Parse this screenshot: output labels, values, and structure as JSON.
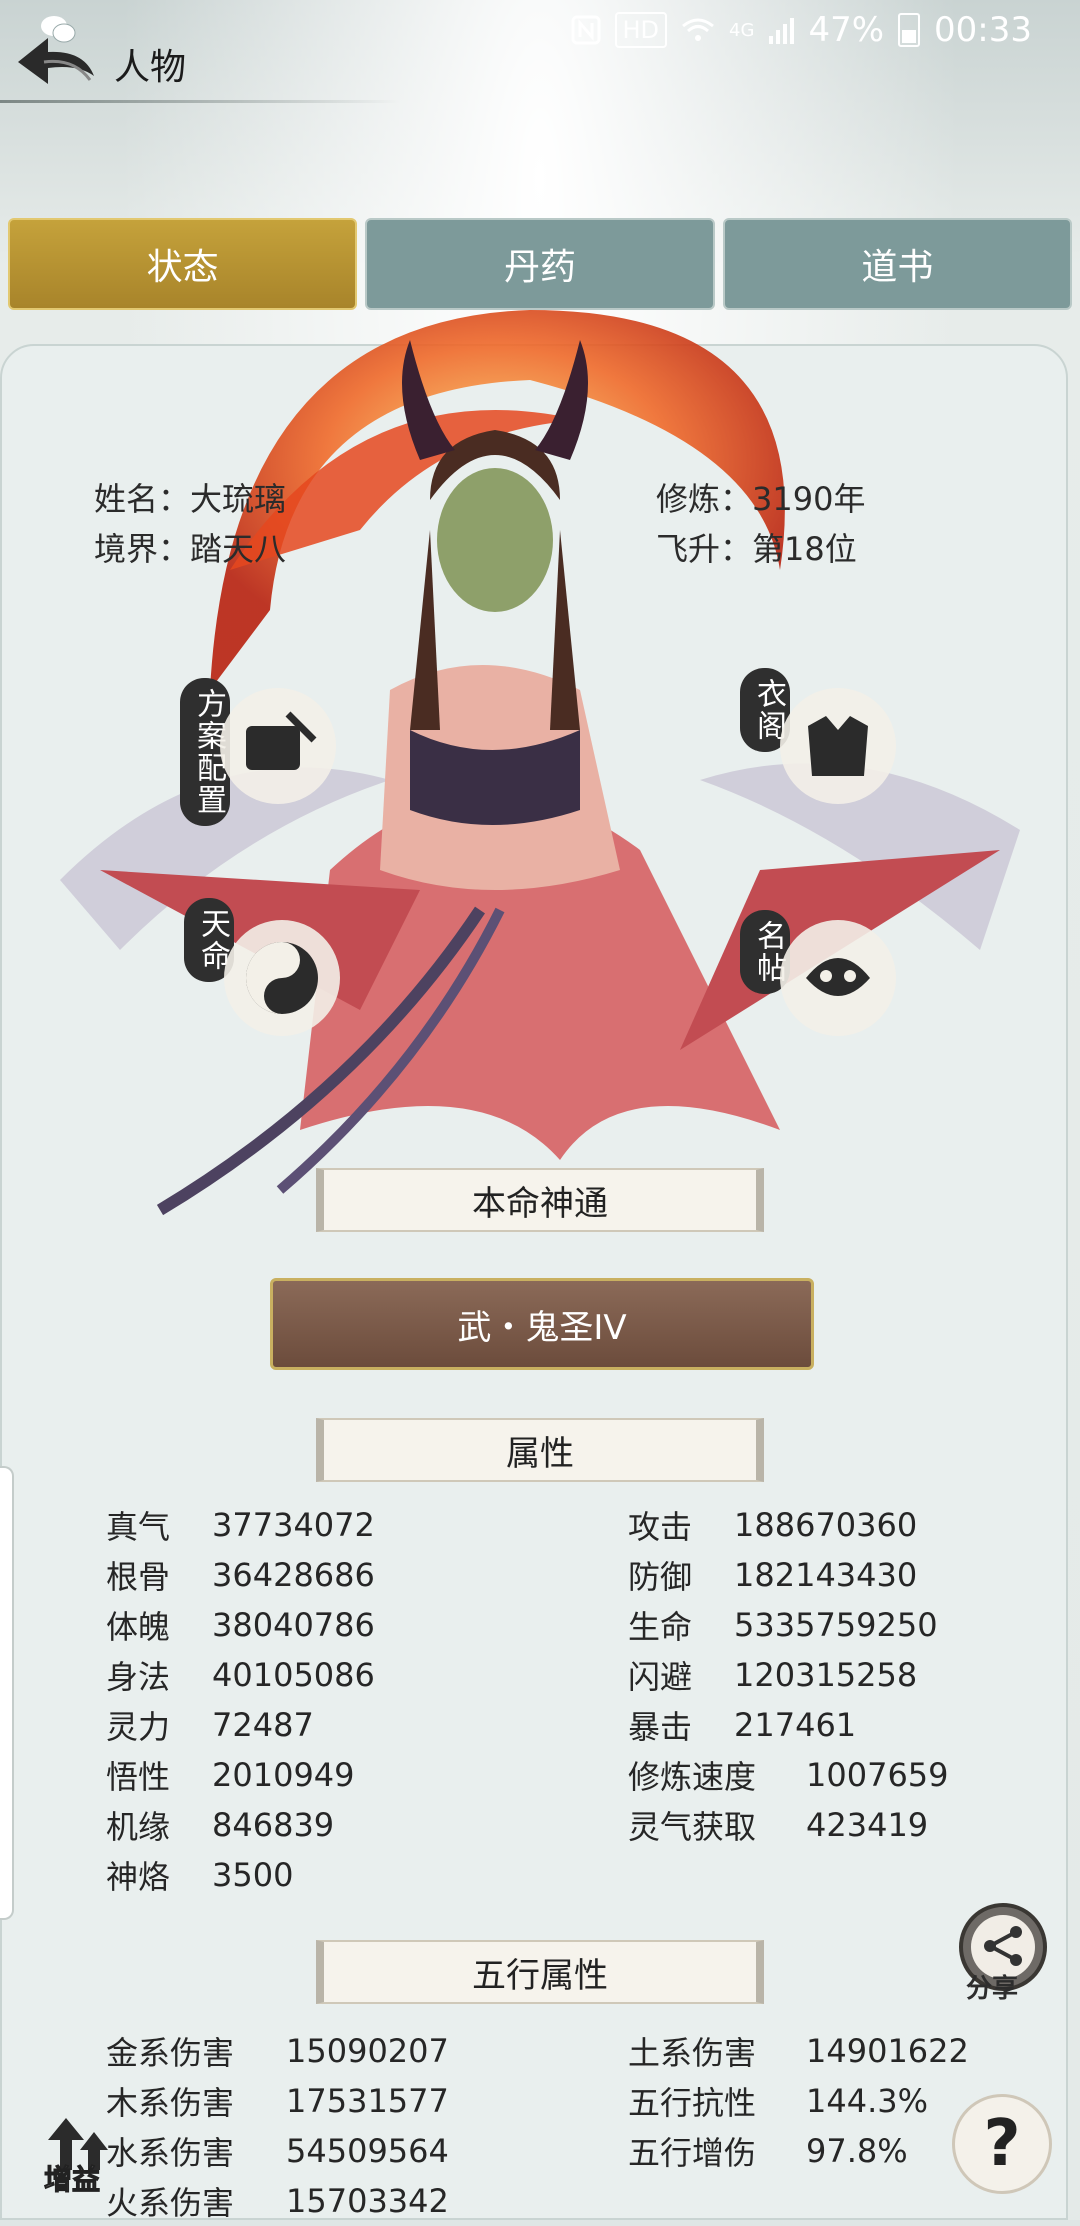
{
  "status_bar": {
    "network_label": "HD",
    "signal_label": "4G",
    "battery": "47%",
    "time": "00:33"
  },
  "nav": {
    "title": "人物"
  },
  "tabs": [
    {
      "label": "状态",
      "active": true
    },
    {
      "label": "丹药",
      "active": false
    },
    {
      "label": "道书",
      "active": false
    }
  ],
  "character": {
    "name_label": "姓名：",
    "name": "大琉璃",
    "realm_label": "境界：",
    "realm": "踏天八",
    "cultivation_label": "修炼：",
    "cultivation": "3190年",
    "ascension_label": "飞升：",
    "ascension": "第18位"
  },
  "side_buttons": {
    "plan": "方案配置",
    "wardrobe": "衣阁",
    "fate": "天命",
    "card": "名帖"
  },
  "natal_skill": {
    "header": "本命神通",
    "value": "武・鬼圣IV"
  },
  "attributes": {
    "header": "属性",
    "left": [
      {
        "k": "真气",
        "v": "37734072"
      },
      {
        "k": "根骨",
        "v": "36428686"
      },
      {
        "k": "体魄",
        "v": "38040786"
      },
      {
        "k": "身法",
        "v": "40105086"
      },
      {
        "k": "灵力",
        "v": "72487"
      },
      {
        "k": "悟性",
        "v": "2010949"
      },
      {
        "k": "机缘",
        "v": "846839"
      },
      {
        "k": "神烙",
        "v": "3500"
      }
    ],
    "right": [
      {
        "k": "攻击",
        "v": "188670360"
      },
      {
        "k": "防御",
        "v": "182143430"
      },
      {
        "k": "生命",
        "v": "5335759250"
      },
      {
        "k": "闪避",
        "v": "120315258"
      },
      {
        "k": "暴击",
        "v": "217461"
      },
      {
        "k": "修炼速度",
        "v": "1007659"
      },
      {
        "k": "灵气获取",
        "v": "423419"
      }
    ]
  },
  "elements": {
    "header": "五行属性",
    "left": [
      {
        "k": "金系伤害",
        "v": "15090207"
      },
      {
        "k": "木系伤害",
        "v": "17531577"
      },
      {
        "k": "水系伤害",
        "v": "54509564"
      },
      {
        "k": "火系伤害",
        "v": "15703342"
      }
    ],
    "right": [
      {
        "k": "土系伤害",
        "v": "14901622"
      },
      {
        "k": "五行抗性",
        "v": "144.3%"
      },
      {
        "k": "五行增伤",
        "v": "97.8%"
      }
    ]
  },
  "floating": {
    "share": "分享",
    "help": "?",
    "buff": "增益"
  },
  "icons": {
    "back": "back-arrow-icon",
    "wechat": "wechat-icon",
    "share": "share-icon"
  },
  "colors": {
    "tab_active": "#b8922f",
    "tab_inactive": "#7d9a9a",
    "skill_button": "#7a5a48",
    "panel": "#e9efee"
  }
}
